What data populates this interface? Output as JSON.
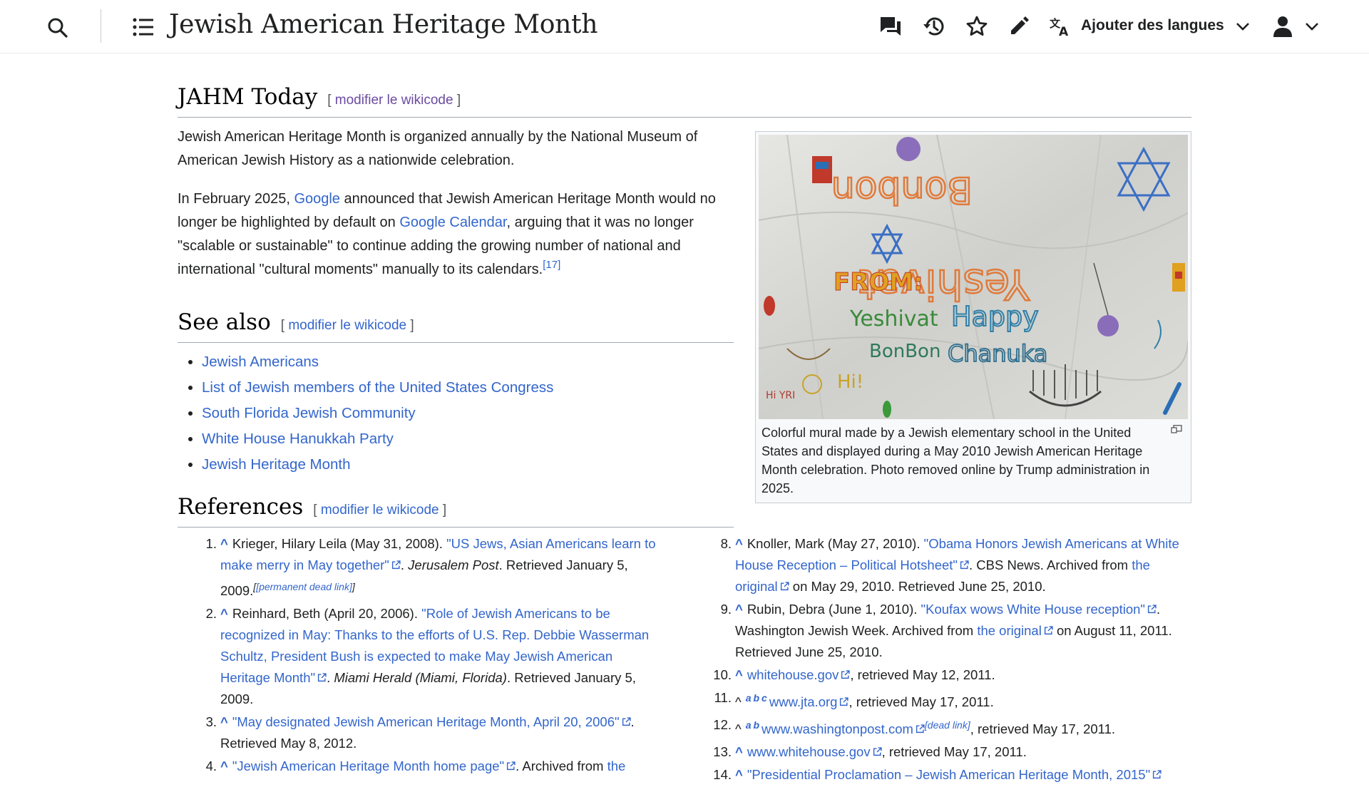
{
  "header": {
    "title": "Jewish American Heritage Month",
    "language_button": "Ajouter des langues",
    "icons": [
      "search-icon",
      "toc-icon",
      "talk-icon",
      "history-icon",
      "star-icon",
      "edit-icon",
      "language-icon",
      "chevron-down-icon",
      "user-icon",
      "chevron-down-icon"
    ]
  },
  "sections": {
    "jahm_today": {
      "heading": "JAHM Today",
      "edit": "modifier le wikicode",
      "p1": "Jewish American Heritage Month is organized annually by the National Museum of American Jewish History as a nationwide celebration.",
      "p2_a": "In February 2025, ",
      "p2_link1": "Google",
      "p2_b": " announced that Jewish American Heritage Month would no longer be highlighted by default on ",
      "p2_link2": "Google Calendar",
      "p2_c": ", arguing that it was no longer \"scalable or sustainable\" to continue adding the growing number of national and international \"cultural moments\" manually to its calendars.",
      "p2_ref": "[17]"
    },
    "see_also": {
      "heading": "See also",
      "edit": "modifier le wikicode",
      "items": [
        "Jewish Americans",
        "List of Jewish members of the United States Congress",
        "South Florida Jewish Community",
        "White House Hanukkah Party",
        "Jewish Heritage Month"
      ]
    },
    "references": {
      "heading": "References",
      "edit": "modifier le wikicode"
    }
  },
  "figure": {
    "caption": "Colorful mural made by a Jewish elementary school in the United States and displayed during a May 2010 Jewish American Heritage Month celebration. Photo removed online by Trump administration in 2025.",
    "mural_text": {
      "from": "FROM:",
      "yeshivat": "Yeshivat",
      "happy": "Happy",
      "bonbon": "BonBon",
      "chanuka": "Chanuka",
      "hi": "Hi!",
      "hi_yri": "Hi YRI",
      "top1": "Yeshivat",
      "top2": "Bonbon"
    }
  },
  "refs_left": [
    {
      "num": "1.",
      "caret": "^",
      "pre": "Krieger, Hilary Leila (May 31, 2008). ",
      "link": "\"US Jews, Asian Americans learn to make merry in May together\"",
      "post1": ". ",
      "italic": "Jerusalem Post",
      "post2": ". Retrieved January 5, 2009.",
      "tag": "[permanent dead link]"
    },
    {
      "num": "2.",
      "caret": "^",
      "pre": "Reinhard, Beth (April 20, 2006). ",
      "link": "\"Role of Jewish Americans to be recognized in May: Thanks to the efforts of U.S. Rep. Debbie Wasserman Schultz, President Bush is expected to make May Jewish American Heritage Month\"",
      "post1": ". ",
      "italic": "Miami Herald (Miami, Florida)",
      "post2": ". Retrieved January 5, 2009."
    },
    {
      "num": "3.",
      "caret": "^",
      "pre": "",
      "link": "\"May designated Jewish American Heritage Month, April 20, 2006\"",
      "post1": ". Retrieved May 8, 2012."
    },
    {
      "num": "4.",
      "caret": "^",
      "pre": "",
      "link": "\"Jewish American Heritage Month home page\"",
      "post1": ". Archived from ",
      "link2": "the"
    }
  ],
  "refs_right": [
    {
      "num": "8.",
      "caret": "^",
      "pre": "Knoller, Mark (May 27, 2010). ",
      "link": "\"Obama Honors Jewish Americans at White House Reception – Political Hotsheet\"",
      "post1": ". CBS News. Archived from ",
      "link2": "the original",
      "post2": " on May 29, 2010. Retrieved June 25, 2010."
    },
    {
      "num": "9.",
      "caret": "^",
      "pre": "Rubin, Debra (June 1, 2010). ",
      "link": "\"Koufax wows White House reception\"",
      "post1": ". Washington Jewish Week. Archived from ",
      "link2": "the original",
      "post2": " on August 11, 2011. Retrieved June 25, 2010."
    },
    {
      "num": "10.",
      "caret": "^",
      "link": "whitehouse.gov",
      "post1": ", retrieved May 12, 2011."
    },
    {
      "num": "11.",
      "caret": "^",
      "letters": [
        "a",
        "b",
        "c"
      ],
      "link": "www.jta.org",
      "post1": ", retrieved May 17, 2011."
    },
    {
      "num": "12.",
      "caret": "^",
      "letters": [
        "a",
        "b"
      ],
      "link": "www.washingtonpost.com",
      "tag": "[dead link]",
      "post1": ", retrieved May 17, 2011."
    },
    {
      "num": "13.",
      "caret": "^",
      "link": "www.whitehouse.gov",
      "post1": ", retrieved May 17, 2011."
    },
    {
      "num": "14.",
      "caret": "^",
      "link": "\"Presidential Proclamation – Jewish American Heritage Month, 2015\""
    }
  ],
  "colors": {
    "link": "#3366cc",
    "visited": "#6b4ba1",
    "text": "#202122"
  }
}
